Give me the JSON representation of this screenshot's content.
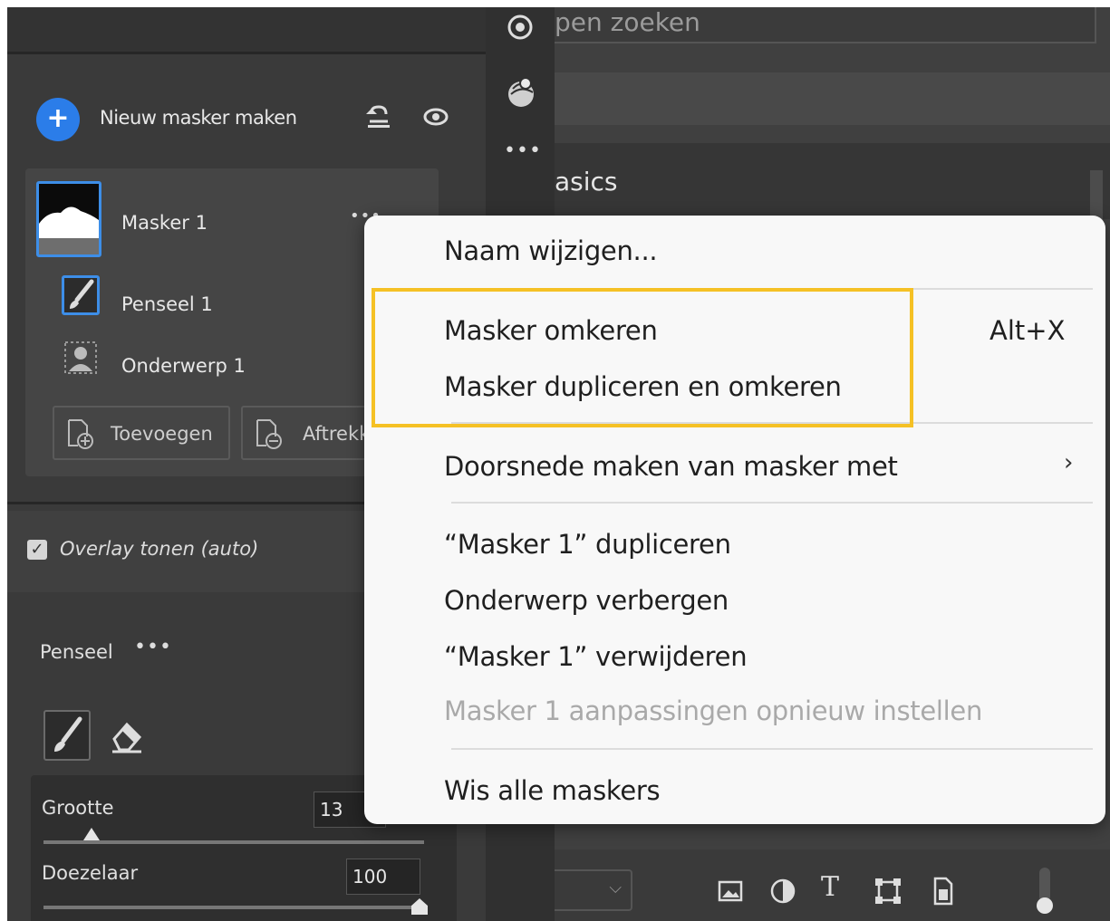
{
  "masks_panel": {
    "new_mask_label": "Nieuw masker maken",
    "mask_name": "Masker 1",
    "mask_more": "•••",
    "components": [
      {
        "label": "Penseel 1",
        "icon": "brush-icon"
      },
      {
        "label": "Onderwerp 1",
        "icon": "subject-icon"
      }
    ],
    "add_label": "Toevoegen",
    "subtract_label": "Aftrekken",
    "overlay_label": "Overlay tonen (auto)",
    "overlay_checked": true
  },
  "brush_panel": {
    "title": "Penseel",
    "more": "•••",
    "size_label": "Grootte",
    "size_value": "13",
    "size_fraction": 0.13,
    "feather_label": "Doezelaar",
    "feather_value": "100",
    "feather_fraction": 1.0
  },
  "tool_strip": {
    "more": "•••"
  },
  "right_panel": {
    "search_text": "pen zoeken",
    "section_title": "asics"
  },
  "context_menu": {
    "items": [
      "Naam wijzigen...",
      "Masker omkeren",
      "Masker dupliceren en omkeren",
      "Doorsnede maken van masker met",
      "“Masker 1” dupliceren",
      "Onderwerp verbergen",
      "“Masker 1” verwijderen",
      "Masker 1 aanpassingen opnieuw instellen",
      "Wis alle maskers"
    ],
    "invert_shortcut": "Alt+X",
    "submenu_arrow": "›",
    "disabled_item": "Masker 1 aanpassingen opnieuw instellen",
    "highlight_color": "#f5c125"
  },
  "colors": {
    "accent_blue": "#2b7de9",
    "selection_border": "#3d8ee8"
  }
}
